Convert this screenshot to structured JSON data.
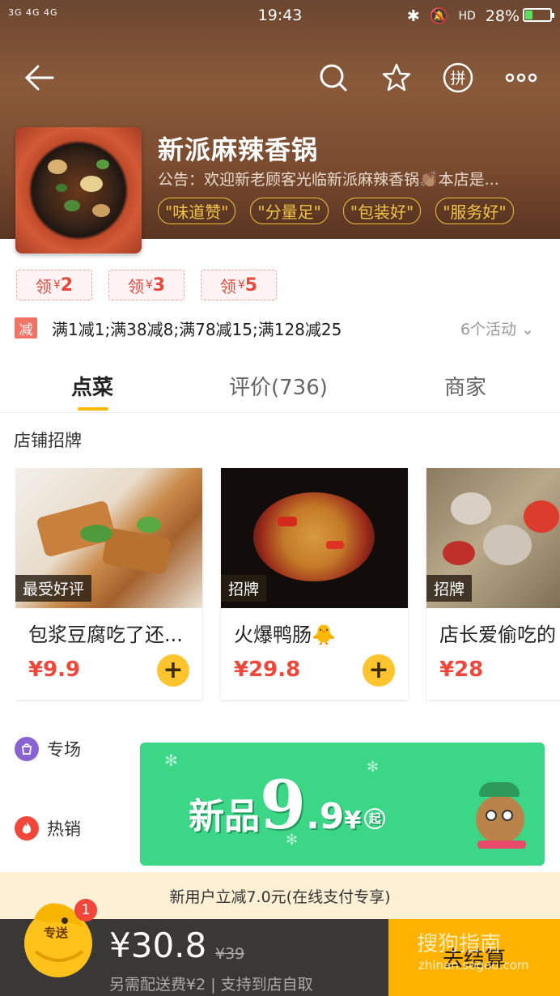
{
  "status_bar": {
    "signal": "3G 4G 4G",
    "time": "19:43",
    "battery": "28%",
    "battery_level": 0.28
  },
  "shop": {
    "name": "新派麻辣香锅",
    "notice": "公告：欢迎新老顾客光临新派麻辣香锅👏🏽本店是...",
    "tags": [
      "\"味道赞\"",
      "\"分量足\"",
      "\"包装好\"",
      "\"服务好\""
    ]
  },
  "coupons": [
    {
      "prefix": "领",
      "currency": "¥",
      "amount": "2"
    },
    {
      "prefix": "领",
      "currency": "¥",
      "amount": "3"
    },
    {
      "prefix": "领",
      "currency": "¥",
      "amount": "5"
    }
  ],
  "promo": {
    "badge": "减",
    "text": "满1减1;满38减8;满78减15;满128减25",
    "more": "6个活动"
  },
  "tabs": [
    "点菜",
    "评价(736)",
    "商家"
  ],
  "section_title": "店铺招牌",
  "dishes": [
    {
      "badge": "最受好评",
      "name": "包浆豆腐吃了还...",
      "price": "¥9.9"
    },
    {
      "badge": "招牌",
      "name": "火爆鸭肠🐥",
      "price": "¥29.8"
    },
    {
      "badge": "招牌",
      "name": "店长爱偷吃的",
      "price": "¥28"
    }
  ],
  "categories": [
    {
      "label": "专场",
      "color": "#8a63d2"
    },
    {
      "label": "热销",
      "color": "#f0473a"
    }
  ],
  "banner": {
    "text_left": "新品",
    "big": "9",
    "dot_nine": ".9",
    "currency": "¥",
    "suffix": "起"
  },
  "tip": "新用户立减7.0元(在线支付专享)",
  "cart": {
    "mascot_label": "专送",
    "count": "1",
    "total": "¥30.8",
    "original": "¥39",
    "fee": "另需配送费¥2 | 支持到店自取",
    "checkout": "去结算"
  },
  "watermark": {
    "text": "搜狗指南",
    "url": "zhinan.sogou.com"
  },
  "colors": {
    "accent": "#ffb800",
    "price": "#f0473a",
    "banner": "#3bd686"
  }
}
